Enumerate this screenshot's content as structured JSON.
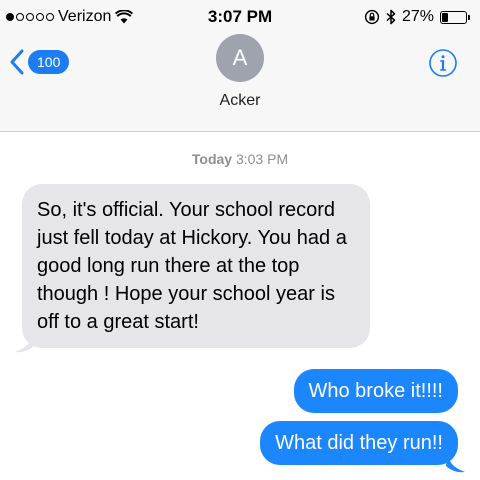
{
  "status_bar": {
    "carrier": "Verizon",
    "time": "3:07 PM",
    "battery_percent": "27%",
    "battery_level": 0.27,
    "signal_bars": 1,
    "signal_total": 5,
    "icons": [
      "wifi-icon",
      "orientation-lock-icon",
      "bluetooth-icon",
      "battery-icon"
    ]
  },
  "nav": {
    "back_count": "100",
    "back_icon": "chevron-left-icon",
    "contact_initial": "A",
    "contact_name": "Acker",
    "info_icon": "info-icon"
  },
  "conversation": {
    "timestamp_day": "Today",
    "timestamp_time": "3:03 PM",
    "messages": [
      {
        "direction": "incoming",
        "text": "So, it's official.  Your school record just fell today at Hickory.  You had a good long run there at the top though !  Hope your school year is off to a great start!"
      },
      {
        "direction": "outgoing",
        "text": "Who broke it!!!!"
      },
      {
        "direction": "outgoing",
        "text": "What did they run!!"
      }
    ]
  },
  "colors": {
    "accent": "#1e7cf2",
    "outgoing_bubble": "#1c86fd",
    "incoming_bubble": "#e5e5ea",
    "header_bg": "#f7f7f7",
    "avatar_bg": "#9ea3ad",
    "timestamp_text": "#8e8e93"
  }
}
